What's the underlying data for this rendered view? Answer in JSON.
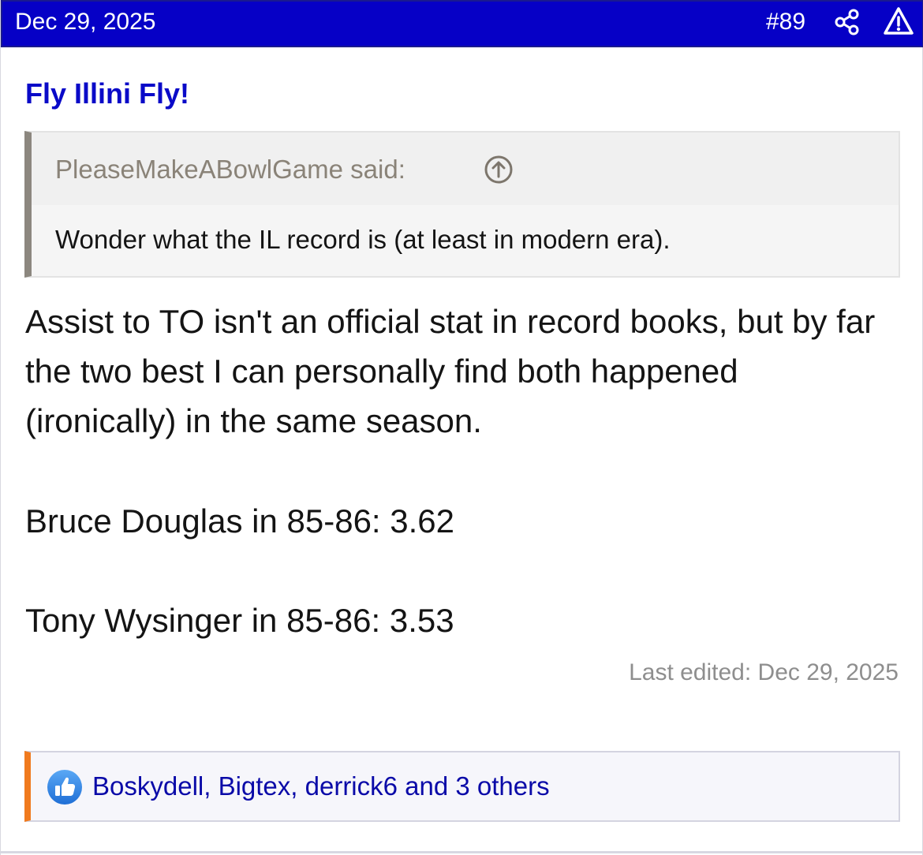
{
  "header": {
    "date": "Dec 29, 2025",
    "post_number": "#89",
    "share_icon": "share-icon",
    "report_icon": "warning-icon",
    "background_color": "#0600c6"
  },
  "post": {
    "username": "Fly Illini Fly!",
    "quote": {
      "author_line": "PleaseMakeABowlGame said:",
      "jump_icon": "arrow-up-circle-icon",
      "text": "Wonder what the IL record is (at least in modern era)."
    },
    "paragraphs": [
      "Assist to TO isn't an official stat in record books, but by far the two best I can personally find both happened (ironically) in the same season.",
      "Bruce Douglas in 85-86: 3.62",
      "Tony Wysinger in 85-86: 3.53"
    ],
    "last_edited": "Last edited: Dec 29, 2025"
  },
  "reactions": {
    "icon": "thumbs-up-icon",
    "text": "Boskydell, Bigtex, derrick6 and 3 others",
    "accent_color": "#f07a1e"
  }
}
